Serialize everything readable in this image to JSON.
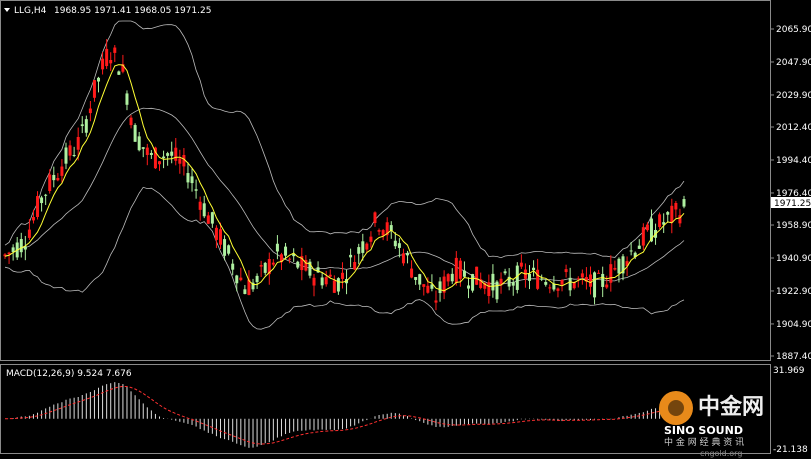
{
  "symbol": "LLG,H4",
  "ohlc": "1968.95 1971.41 1968.05 1971.25",
  "current_price": "1971.25",
  "macd_label": "MACD(12,26,9) 9.524 7.676",
  "watermark": {
    "cn": "中金网",
    "en": "SINO SOUND",
    "sub": "中 金 网 经 典 资 讯",
    "url": "cngold.org"
  },
  "colors": {
    "bull": "#aef0a0",
    "bear": "#ff1a1a",
    "ma": "#ffff33",
    "band": "#bbbbbb",
    "macd_signal": "#ff3030"
  },
  "chart_data": [
    {
      "type": "candlestick",
      "title": "LLG,H4",
      "price_ticks": [
        "2065.90",
        "2047.90",
        "2029.90",
        "2012.40",
        "1994.40",
        "1976.40",
        "1958.90",
        "1940.90",
        "1922.90",
        "1904.90",
        "1887.40"
      ],
      "ylim": [
        1887.4,
        2065.9
      ],
      "overlays": [
        "Bollinger Bands",
        "Moving Average"
      ]
    },
    {
      "type": "bar",
      "title": "MACD(12,26,9)",
      "macd": 9.524,
      "signal": 7.676,
      "ylim": [
        -21.138,
        31.969
      ],
      "y_ticks": [
        "31.969",
        "-21.138"
      ]
    }
  ]
}
